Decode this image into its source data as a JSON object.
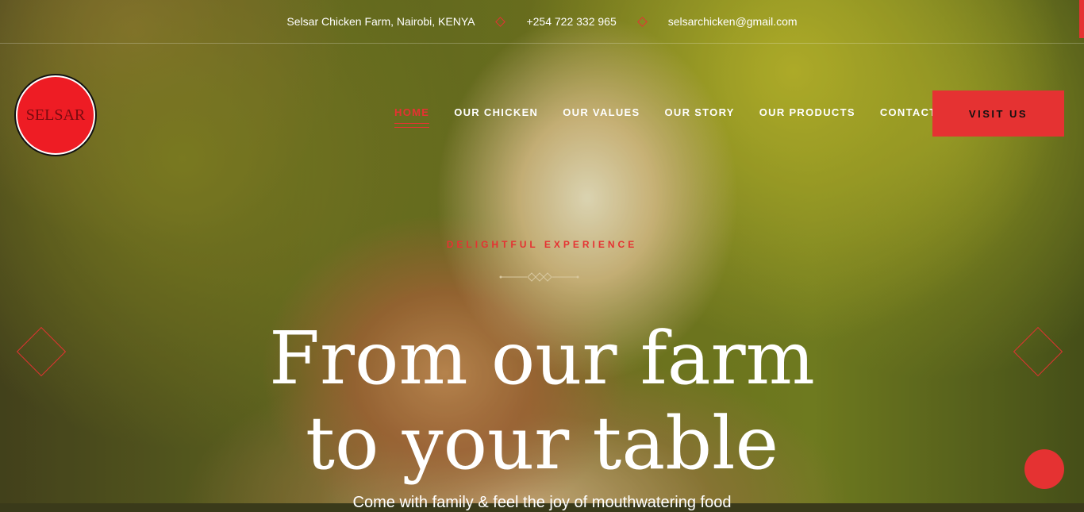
{
  "topbar": {
    "location": "Selsar Chicken Farm, Nairobi, KENYA",
    "phone": "+254 722 332 965",
    "email": "selsarchicken@gmail.com"
  },
  "logo": {
    "text": "SELSAR"
  },
  "nav": {
    "items": [
      {
        "label": "HOME"
      },
      {
        "label": "OUR CHICKEN"
      },
      {
        "label": "OUR VALUES"
      },
      {
        "label": "OUR STORY"
      },
      {
        "label": "OUR PRODUCTS"
      },
      {
        "label": "CONTACT"
      }
    ],
    "cta": "VISIT US"
  },
  "hero": {
    "tagline": "DELIGHTFUL EXPERIENCE",
    "headline_line1": "From our farm",
    "headline_line2": "to your table",
    "subtitle": "Come with family & feel the joy of mouthwatering food"
  },
  "colors": {
    "accent": "#e53232",
    "logo_red": "#ee1c24"
  }
}
